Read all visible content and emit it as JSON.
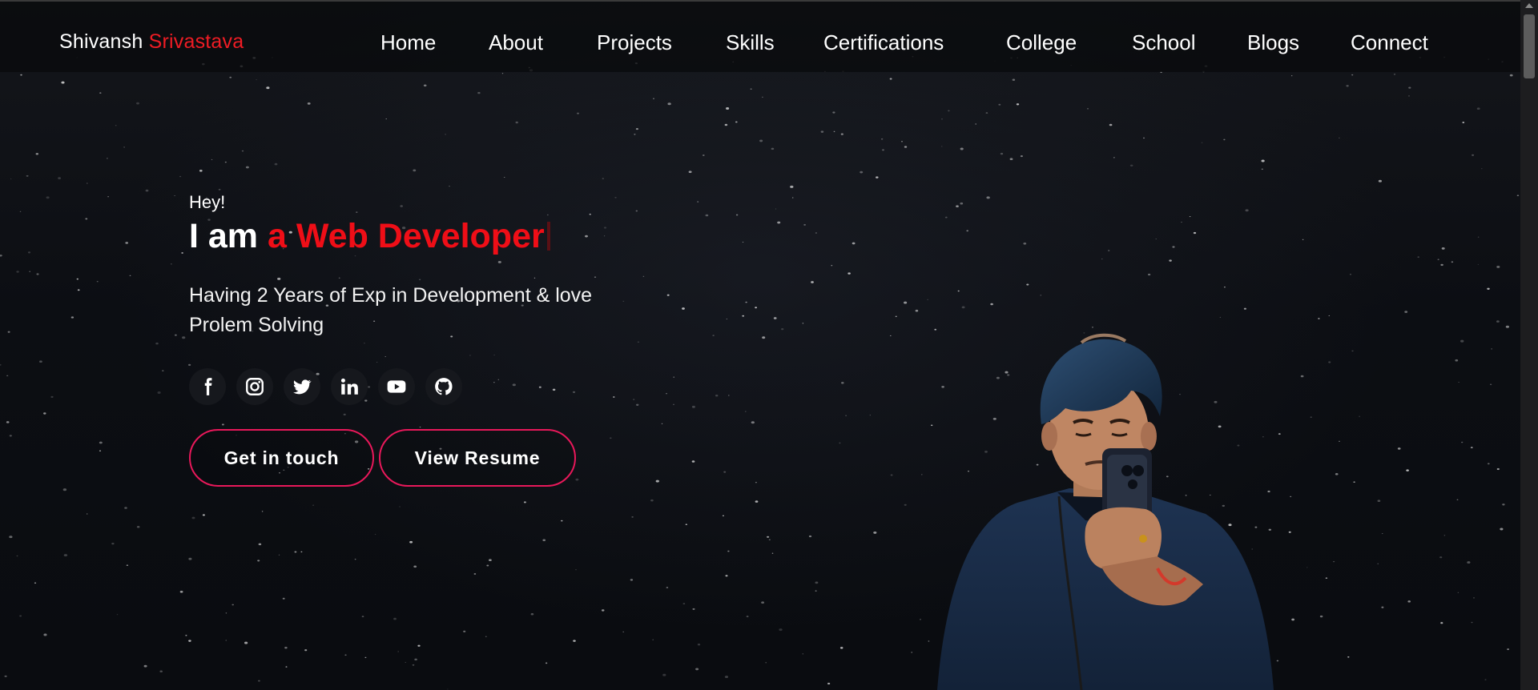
{
  "logo": {
    "first": "Shivansh",
    "last": "Srivastava"
  },
  "nav": [
    {
      "label": "Home",
      "name": "nav-home"
    },
    {
      "label": "About",
      "name": "nav-about"
    },
    {
      "label": "Projects",
      "name": "nav-projects"
    },
    {
      "label": "Skills",
      "name": "nav-skills"
    },
    {
      "label": "Certifications",
      "name": "nav-certifications"
    },
    {
      "label": "College",
      "name": "nav-college"
    },
    {
      "label": "School",
      "name": "nav-school"
    },
    {
      "label": "Blogs",
      "name": "nav-blogs"
    },
    {
      "label": "Connect",
      "name": "nav-connect"
    }
  ],
  "hero": {
    "greeting": "Hey!",
    "intro": "I am",
    "role": "a Web Developer",
    "tagline": "Having 2 Years of Exp in Development & love Prolem Solving"
  },
  "socials": [
    {
      "name": "facebook-icon"
    },
    {
      "name": "instagram-icon"
    },
    {
      "name": "twitter-icon"
    },
    {
      "name": "linkedin-icon"
    },
    {
      "name": "youtube-icon"
    },
    {
      "name": "github-icon"
    }
  ],
  "buttons": {
    "contact": "Get in touch",
    "resume": "View Resume"
  },
  "colors": {
    "accent": "#ef1c24",
    "button_border": "#e8185a",
    "background": "#0b0d12"
  }
}
